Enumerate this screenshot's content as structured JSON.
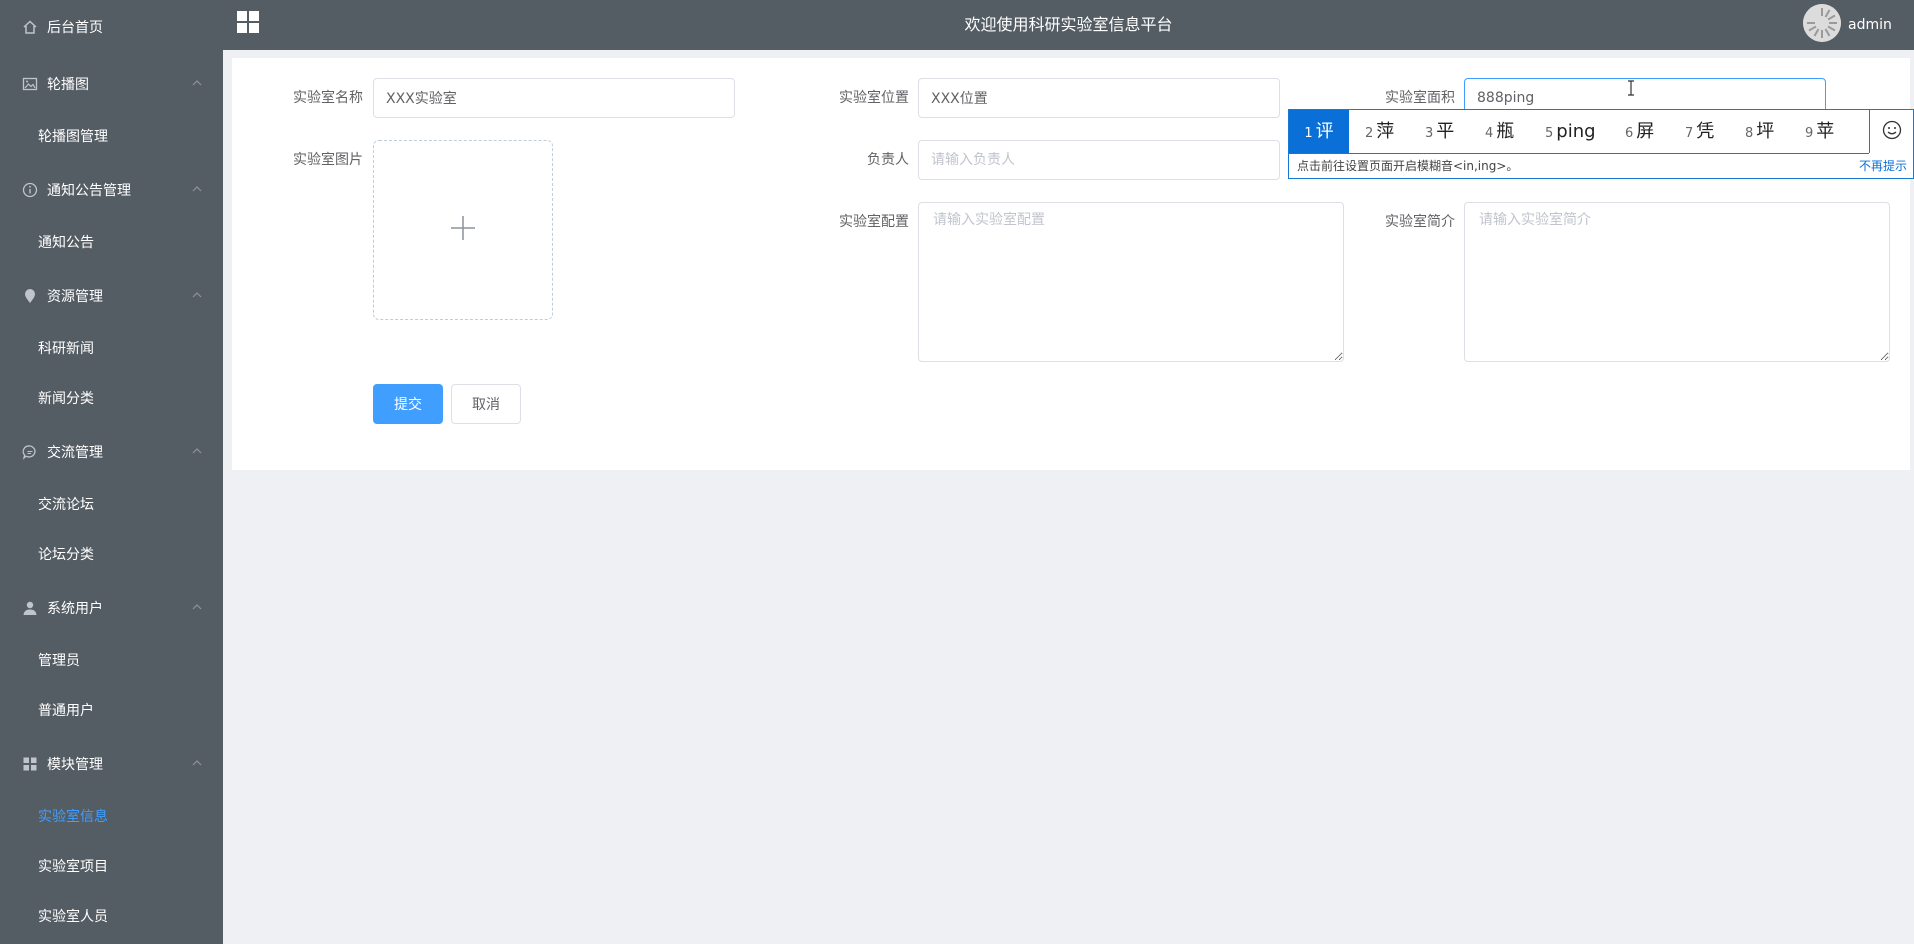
{
  "sidebar": {
    "menus": [
      {
        "label": "后台首页",
        "icon": "home-icon",
        "expandable": false
      },
      {
        "label": "轮播图",
        "icon": "image-icon",
        "expandable": true,
        "children": [
          "轮播图管理"
        ]
      },
      {
        "label": "通知公告管理",
        "icon": "info-icon",
        "expandable": true,
        "children": [
          "通知公告"
        ]
      },
      {
        "label": "资源管理",
        "icon": "location-icon",
        "expandable": true,
        "children": [
          "科研新闻",
          "新闻分类"
        ]
      },
      {
        "label": "交流管理",
        "icon": "chat-icon",
        "expandable": true,
        "children": [
          "交流论坛",
          "论坛分类"
        ]
      },
      {
        "label": "系统用户",
        "icon": "user-icon",
        "expandable": true,
        "children": [
          "管理员",
          "普通用户"
        ]
      },
      {
        "label": "模块管理",
        "icon": "grid-icon",
        "expandable": true,
        "children": [
          "实验室信息",
          "实验室项目",
          "实验室人员"
        ]
      }
    ],
    "active_item": "实验室信息"
  },
  "header": {
    "title": "欢迎使用科研实验室信息平台",
    "username": "admin"
  },
  "form": {
    "name_label": "实验室名称",
    "name_value": "XXX实验室",
    "location_label": "实验室位置",
    "location_value": "XXX位置",
    "area_label": "实验室面积",
    "area_value": "888ping",
    "image_label": "实验室图片",
    "owner_label": "负责人",
    "owner_placeholder": "请输入负责人",
    "config_label": "实验室配置",
    "config_placeholder": "请输入实验室配置",
    "intro_label": "实验室简介",
    "intro_placeholder": "请输入实验室简介",
    "submit_label": "提交",
    "cancel_label": "取消"
  },
  "ime": {
    "candidates": [
      {
        "num": "1",
        "text": "评"
      },
      {
        "num": "2",
        "text": "萍"
      },
      {
        "num": "3",
        "text": "平"
      },
      {
        "num": "4",
        "text": "瓶"
      },
      {
        "num": "5",
        "text": "ping"
      },
      {
        "num": "6",
        "text": "屏"
      },
      {
        "num": "7",
        "text": "凭"
      },
      {
        "num": "8",
        "text": "坪"
      },
      {
        "num": "9",
        "text": "苹"
      }
    ],
    "hint": "点击前往设置页面开启模糊音<in,ing>。",
    "dismiss": "不再提示",
    "emoji_icon": "smiley-icon"
  },
  "colors": {
    "sidebar_bg": "#545c64",
    "accent": "#409eff",
    "ime_selected": "#0a6fd6"
  }
}
